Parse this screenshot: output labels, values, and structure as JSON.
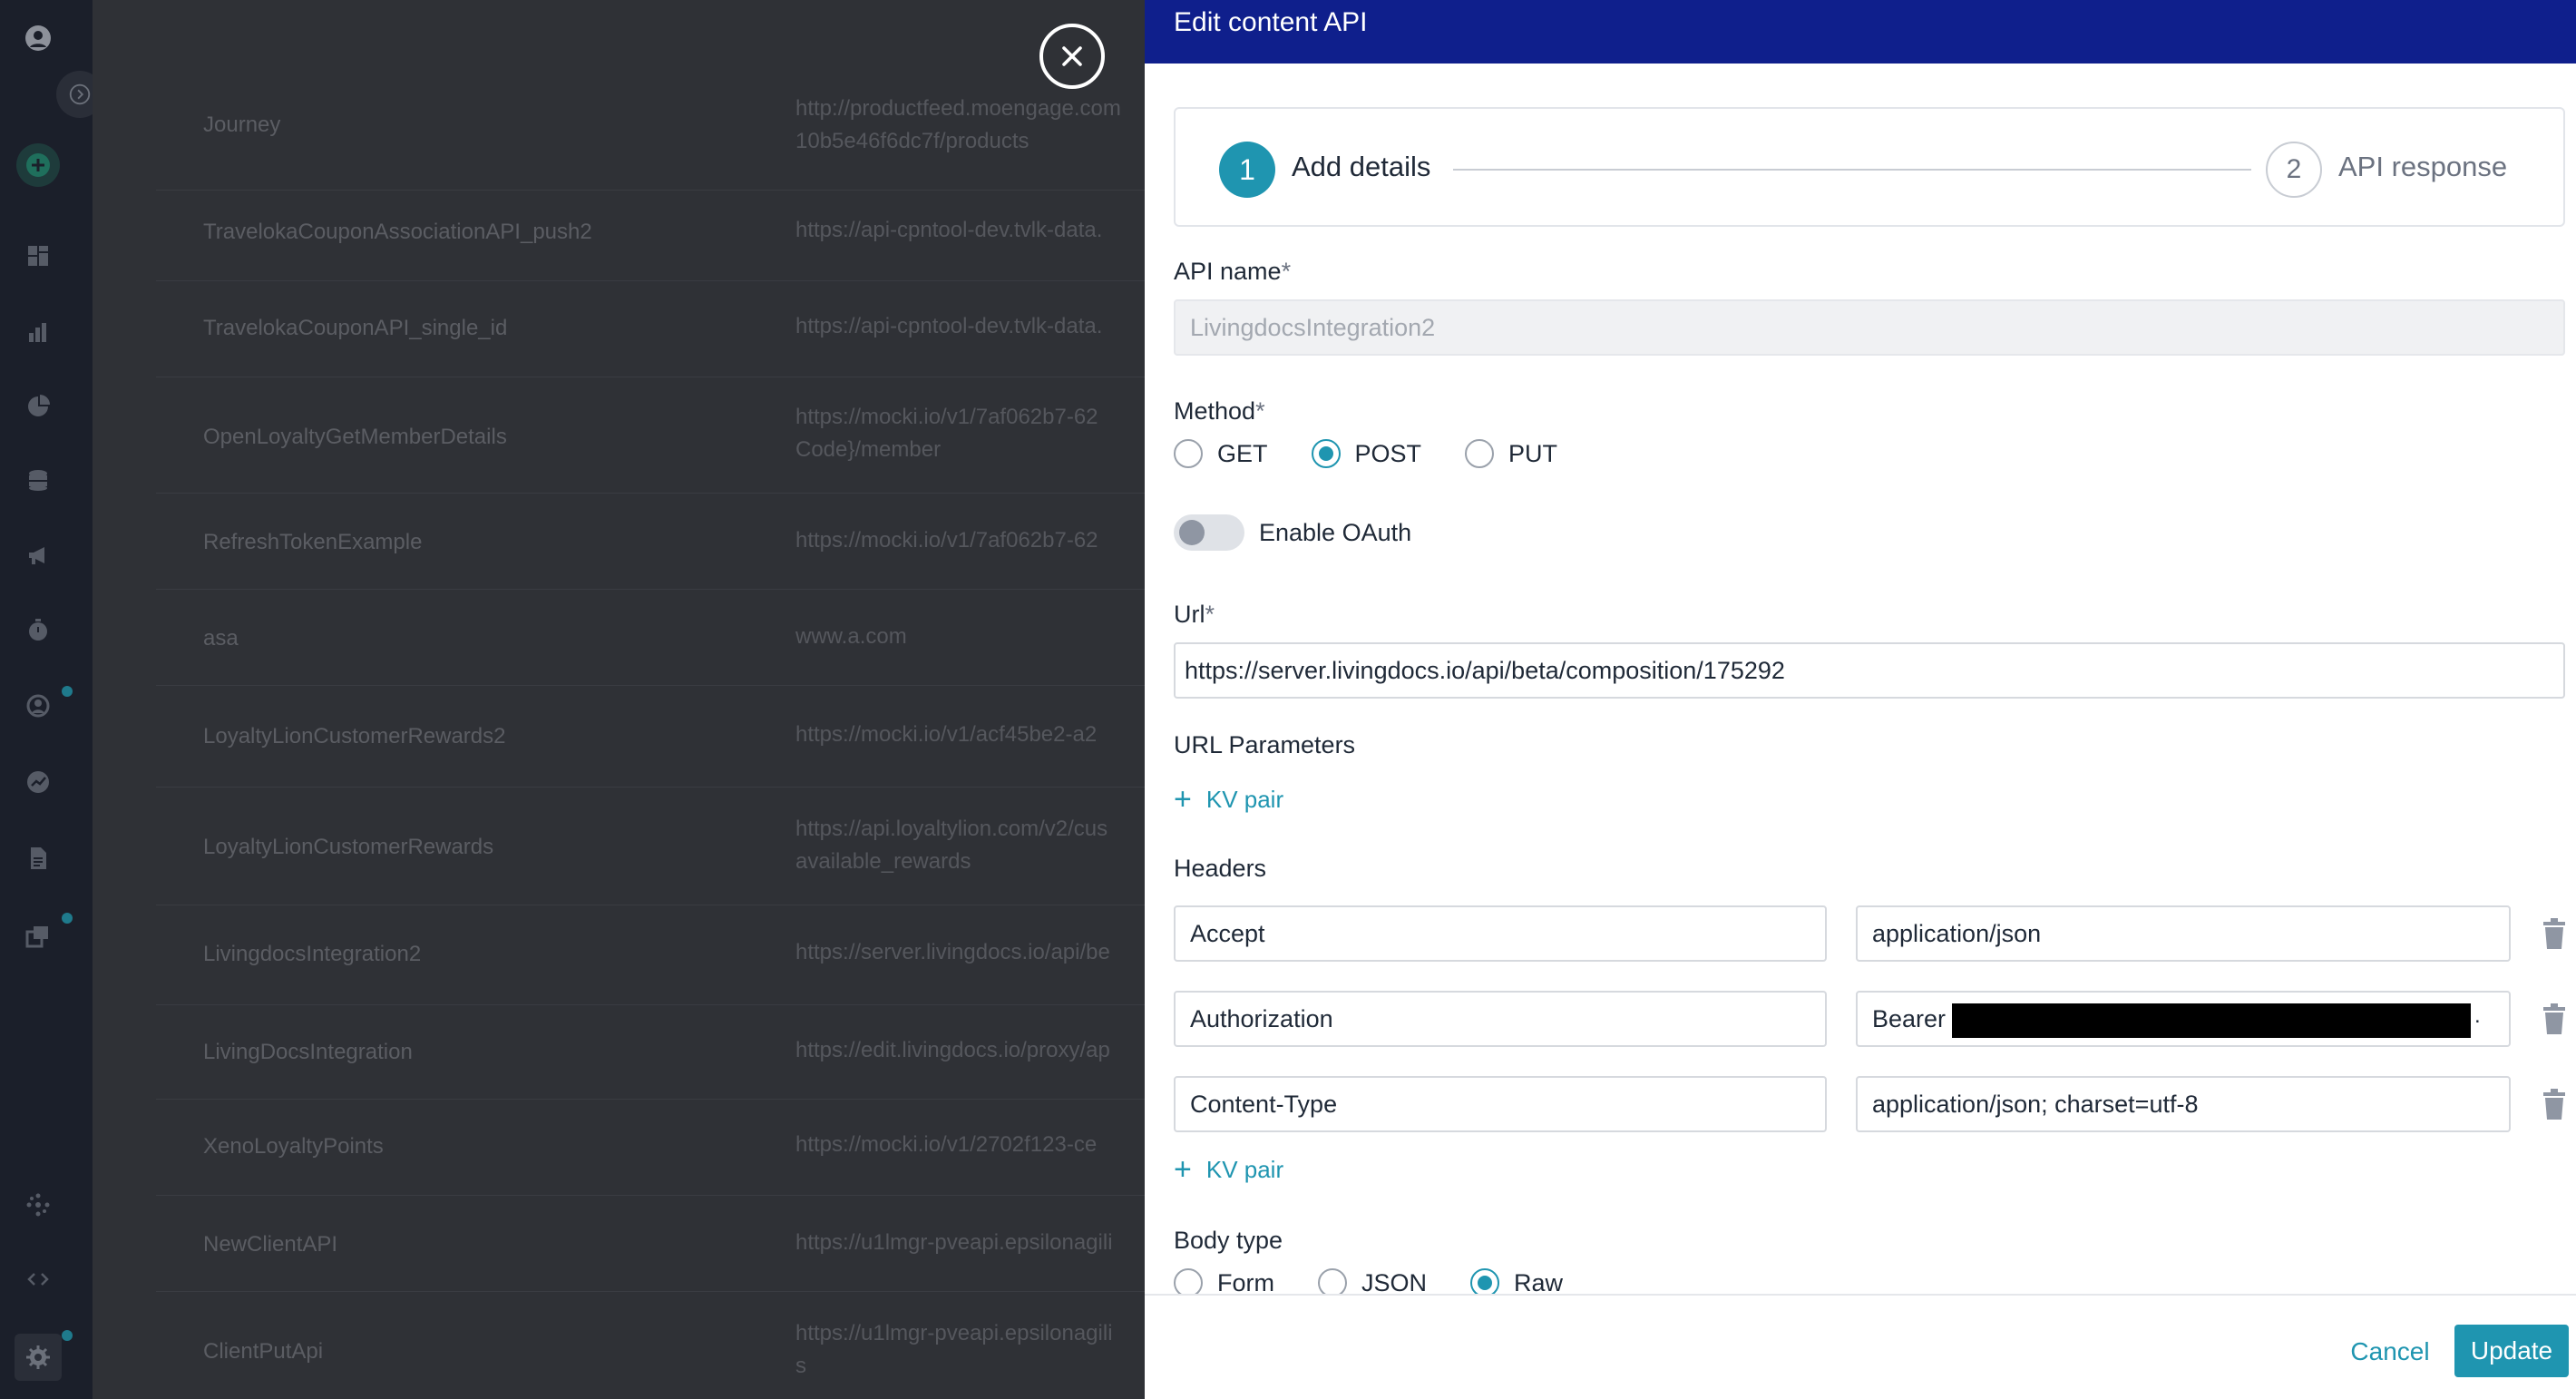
{
  "background_list": {
    "rows": [
      {
        "name": "Journey",
        "url_line1": "http://productfeed.moengage.com",
        "url_line2": "10b5e46f6dc7f/products"
      },
      {
        "name": "TravelokaCouponAssociationAPI_push2",
        "url_line1": "https://api-cpntool-dev.tvlk-data.",
        "url_line2": ""
      },
      {
        "name": "TravelokaCouponAPI_single_id",
        "url_line1": "https://api-cpntool-dev.tvlk-data.",
        "url_line2": ""
      },
      {
        "name": "OpenLoyaltyGetMemberDetails",
        "url_line1": "https://mocki.io/v1/7af062b7-62",
        "url_line2": "Code}/member"
      },
      {
        "name": "RefreshTokenExample",
        "url_line1": "https://mocki.io/v1/7af062b7-62",
        "url_line2": ""
      },
      {
        "name": "asa",
        "url_line1": "www.a.com",
        "url_line2": ""
      },
      {
        "name": "LoyaltyLionCustomerRewards2",
        "url_line1": "https://mocki.io/v1/acf45be2-a2",
        "url_line2": ""
      },
      {
        "name": "LoyaltyLionCustomerRewards",
        "url_line1": "https://api.loyaltylion.com/v2/cus",
        "url_line2": "available_rewards"
      },
      {
        "name": "LivingdocsIntegration2",
        "url_line1": "https://server.livingdocs.io/api/be",
        "url_line2": ""
      },
      {
        "name": "LivingDocsIntegration",
        "url_line1": "https://edit.livingdocs.io/proxy/ap",
        "url_line2": ""
      },
      {
        "name": "XenoLoyaltyPoints",
        "url_line1": "https://mocki.io/v1/2702f123-ce",
        "url_line2": ""
      },
      {
        "name": "NewClientAPI",
        "url_line1": "https://u1lmgr-pveapi.epsilonagili",
        "url_line2": ""
      },
      {
        "name": "ClientPutApi",
        "url_line1": "https://u1lmgr-pveapi.epsilonagili",
        "url_line2": "s"
      }
    ]
  },
  "drawer": {
    "title": "Edit content API",
    "steps": [
      {
        "number": "1",
        "label": "Add details"
      },
      {
        "number": "2",
        "label": "API response"
      }
    ],
    "api_name": {
      "label": "API name",
      "required": "*",
      "value": "LivingdocsIntegration2"
    },
    "method": {
      "label": "Method",
      "required": "*",
      "options": [
        "GET",
        "POST",
        "PUT"
      ],
      "selected": "POST"
    },
    "oauth": {
      "label": "Enable OAuth",
      "enabled": false
    },
    "url": {
      "label": "Url",
      "required": "*",
      "value": "https://server.livingdocs.io/api/beta/composition/175292"
    },
    "url_params": {
      "label": "URL Parameters",
      "add_label": "KV pair"
    },
    "headers": {
      "label": "Headers",
      "rows": [
        {
          "key": "Accept",
          "value": "application/json"
        },
        {
          "key": "Authorization",
          "value": "Bearer",
          "suffix": "."
        },
        {
          "key": "Content-Type",
          "value": "application/json; charset=utf-8"
        }
      ],
      "add_label": "KV pair"
    },
    "body_type": {
      "label": "Body type",
      "options": [
        "Form",
        "JSON",
        "Raw"
      ],
      "selected": "Raw"
    },
    "footer": {
      "cancel": "Cancel",
      "update": "Update"
    }
  },
  "colors": {
    "accent": "#1f95b0",
    "header": "#0f1f8c"
  }
}
